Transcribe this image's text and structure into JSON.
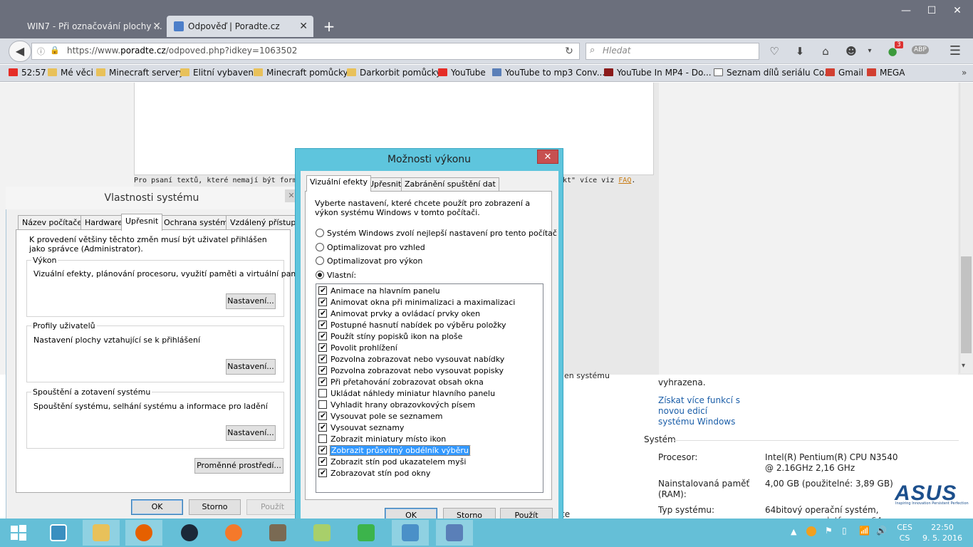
{
  "browser": {
    "tabs": [
      {
        "label": "WIN7 - Při označování plochy ..."
      },
      {
        "label": "Odpověď | Poradte.cz"
      }
    ],
    "url_prefix": "https://www.",
    "url_domain": "poradte.cz",
    "url_path": "/odpoved.php?idkey=1063502",
    "search_placeholder": "Hledat",
    "bookmarks": [
      {
        "label": "52:57",
        "icon": "youtube-icon"
      },
      {
        "label": "Mé věci",
        "icon": "folder-icon"
      },
      {
        "label": "Minecraft servery",
        "icon": "folder-icon"
      },
      {
        "label": "Elitní vybavení",
        "icon": "folder-icon"
      },
      {
        "label": "Minecraft pomůcky",
        "icon": "folder-icon"
      },
      {
        "label": "Darkorbit pomůcky",
        "icon": "folder-icon"
      },
      {
        "label": "YouTube",
        "icon": "youtube-icon"
      },
      {
        "label": "YouTube to mp3 Conv...",
        "icon": "mp3-icon"
      },
      {
        "label": "YouTube In MP4 - Do...",
        "icon": "mp4-icon"
      },
      {
        "label": "Seznam dílů seriálu Co...",
        "icon": "wikipedia-icon"
      },
      {
        "label": "Gmail",
        "icon": "gmail-icon"
      },
      {
        "label": "MEGA",
        "icon": "mega-icon"
      }
    ],
    "badge_count": "3",
    "abp_label": "ABP"
  },
  "page": {
    "write_note_start": "Pro psaní textů, které nemají být formát",
    "write_note_end": "kt\" více viz ",
    "faq_link": "FAQ",
    "faq_after": "."
  },
  "system_info": {
    "reserved": "vyhrazena.",
    "more_features": [
      "Získat více funkcí s",
      "novou edicí",
      "systému Windows"
    ],
    "section": "Systém",
    "processor_label": "Procesor:",
    "processor_value": [
      "Intel(R) Pentium(R) CPU  N3540",
      "@ 2.16GHz   2,16 GHz"
    ],
    "memory_label": [
      "Nainstalovaná paměť",
      "(RAM):"
    ],
    "memory_value": "4,00 GB (použitelné: 3,89 GB)",
    "type_label": "Typ systému:",
    "type_value": [
      "64bitový operační systém,",
      "procesor pro platformu x64"
    ],
    "cut_text_1": "en systému",
    "cut_text_2": "te"
  },
  "sys_props": {
    "title": "Vlastnosti systému",
    "tabs": [
      "Název počítače",
      "Hardware",
      "Upřesnit",
      "Ochrana systému",
      "Vzdálený přístup"
    ],
    "admin_note": "K provedení většiny těchto změn musí být uživatel přihlášen jako správce (Administrator).",
    "groups": [
      {
        "title": "Výkon",
        "desc": "Vizuální efekty, plánování procesoru, využití paměti a virtuální paměť",
        "button": "Nastavení..."
      },
      {
        "title": "Profily uživatelů",
        "desc": "Nastavení plochy vztahující se k přihlášení",
        "button": "Nastavení..."
      },
      {
        "title": "Spouštění a zotavení systému",
        "desc": "Spouštění systému, selhání systému a informace pro ladění",
        "button": "Nastavení..."
      }
    ],
    "env_button": "Proměnné prostředí...",
    "ok": "OK",
    "cancel": "Storno",
    "apply": "Použít"
  },
  "perf_options": {
    "title": "Možnosti výkonu",
    "tabs": [
      "Vizuální efekty",
      "Upřesnit",
      "Zabránění spuštění dat"
    ],
    "intro": "Vyberte nastavení, které chcete použít pro zobrazení a výkon systému Windows v tomto počítači.",
    "radios": [
      {
        "label": "Systém Windows zvolí nejlepší nastavení pro tento počítač",
        "selected": false
      },
      {
        "label": "Optimalizovat pro vzhled",
        "selected": false
      },
      {
        "label": "Optimalizovat pro výkon",
        "selected": false
      },
      {
        "label": "Vlastní:",
        "selected": true
      }
    ],
    "effects": [
      {
        "label": "Animace na hlavním panelu",
        "checked": true
      },
      {
        "label": "Animovat okna při minimalizaci a maximalizaci",
        "checked": true
      },
      {
        "label": "Animovat prvky a ovládací prvky oken",
        "checked": true
      },
      {
        "label": "Postupné hasnutí nabídek po výběru položky",
        "checked": true
      },
      {
        "label": "Použít stíny popisků ikon na ploše",
        "checked": true
      },
      {
        "label": "Povolit prohlížení",
        "checked": true
      },
      {
        "label": "Pozvolna zobrazovat nebo vysouvat nabídky",
        "checked": true
      },
      {
        "label": "Pozvolna zobrazovat nebo vysouvat popisky",
        "checked": true
      },
      {
        "label": "Při přetahování zobrazovat obsah okna",
        "checked": true
      },
      {
        "label": "Ukládat náhledy miniatur hlavního panelu",
        "checked": false
      },
      {
        "label": "Vyhladit hrany obrazovkových písem",
        "checked": false
      },
      {
        "label": "Vysouvat pole se seznamem",
        "checked": true
      },
      {
        "label": "Vysouvat seznamy",
        "checked": true
      },
      {
        "label": "Zobrazit miniatury místo ikon",
        "checked": false
      },
      {
        "label": "Zobrazit průsvitný obdélník výběru",
        "checked": true,
        "highlighted": true
      },
      {
        "label": "Zobrazit stín pod ukazatelem myši",
        "checked": true
      },
      {
        "label": "Zobrazovat stín pod okny",
        "checked": true
      }
    ],
    "ok": "OK",
    "cancel": "Storno",
    "apply": "Použít"
  },
  "taskbar": {
    "lang_top": "CES",
    "lang_bottom": "CS",
    "time": "22:50",
    "date": "9. 5. 2016",
    "apps": [
      "start-icon",
      "file-explorer-icon",
      "folder-icon",
      "firefox-icon",
      "steam-icon",
      "blender-icon",
      "gimp-icon",
      "notepad-icon",
      "bluestacks-icon",
      "control-panel-icon",
      "system-properties-icon"
    ]
  },
  "brand": {
    "logo": "ASUS",
    "tagline": "Inspiring Innovation  Persistent Perfection"
  },
  "colors": {
    "taskbar": "#65bfd7",
    "dialog_frame": "#5ec5dd",
    "link": "#1b5ea8",
    "highlight": "#3399ff",
    "browser_tabs": "#6b6f7c"
  }
}
